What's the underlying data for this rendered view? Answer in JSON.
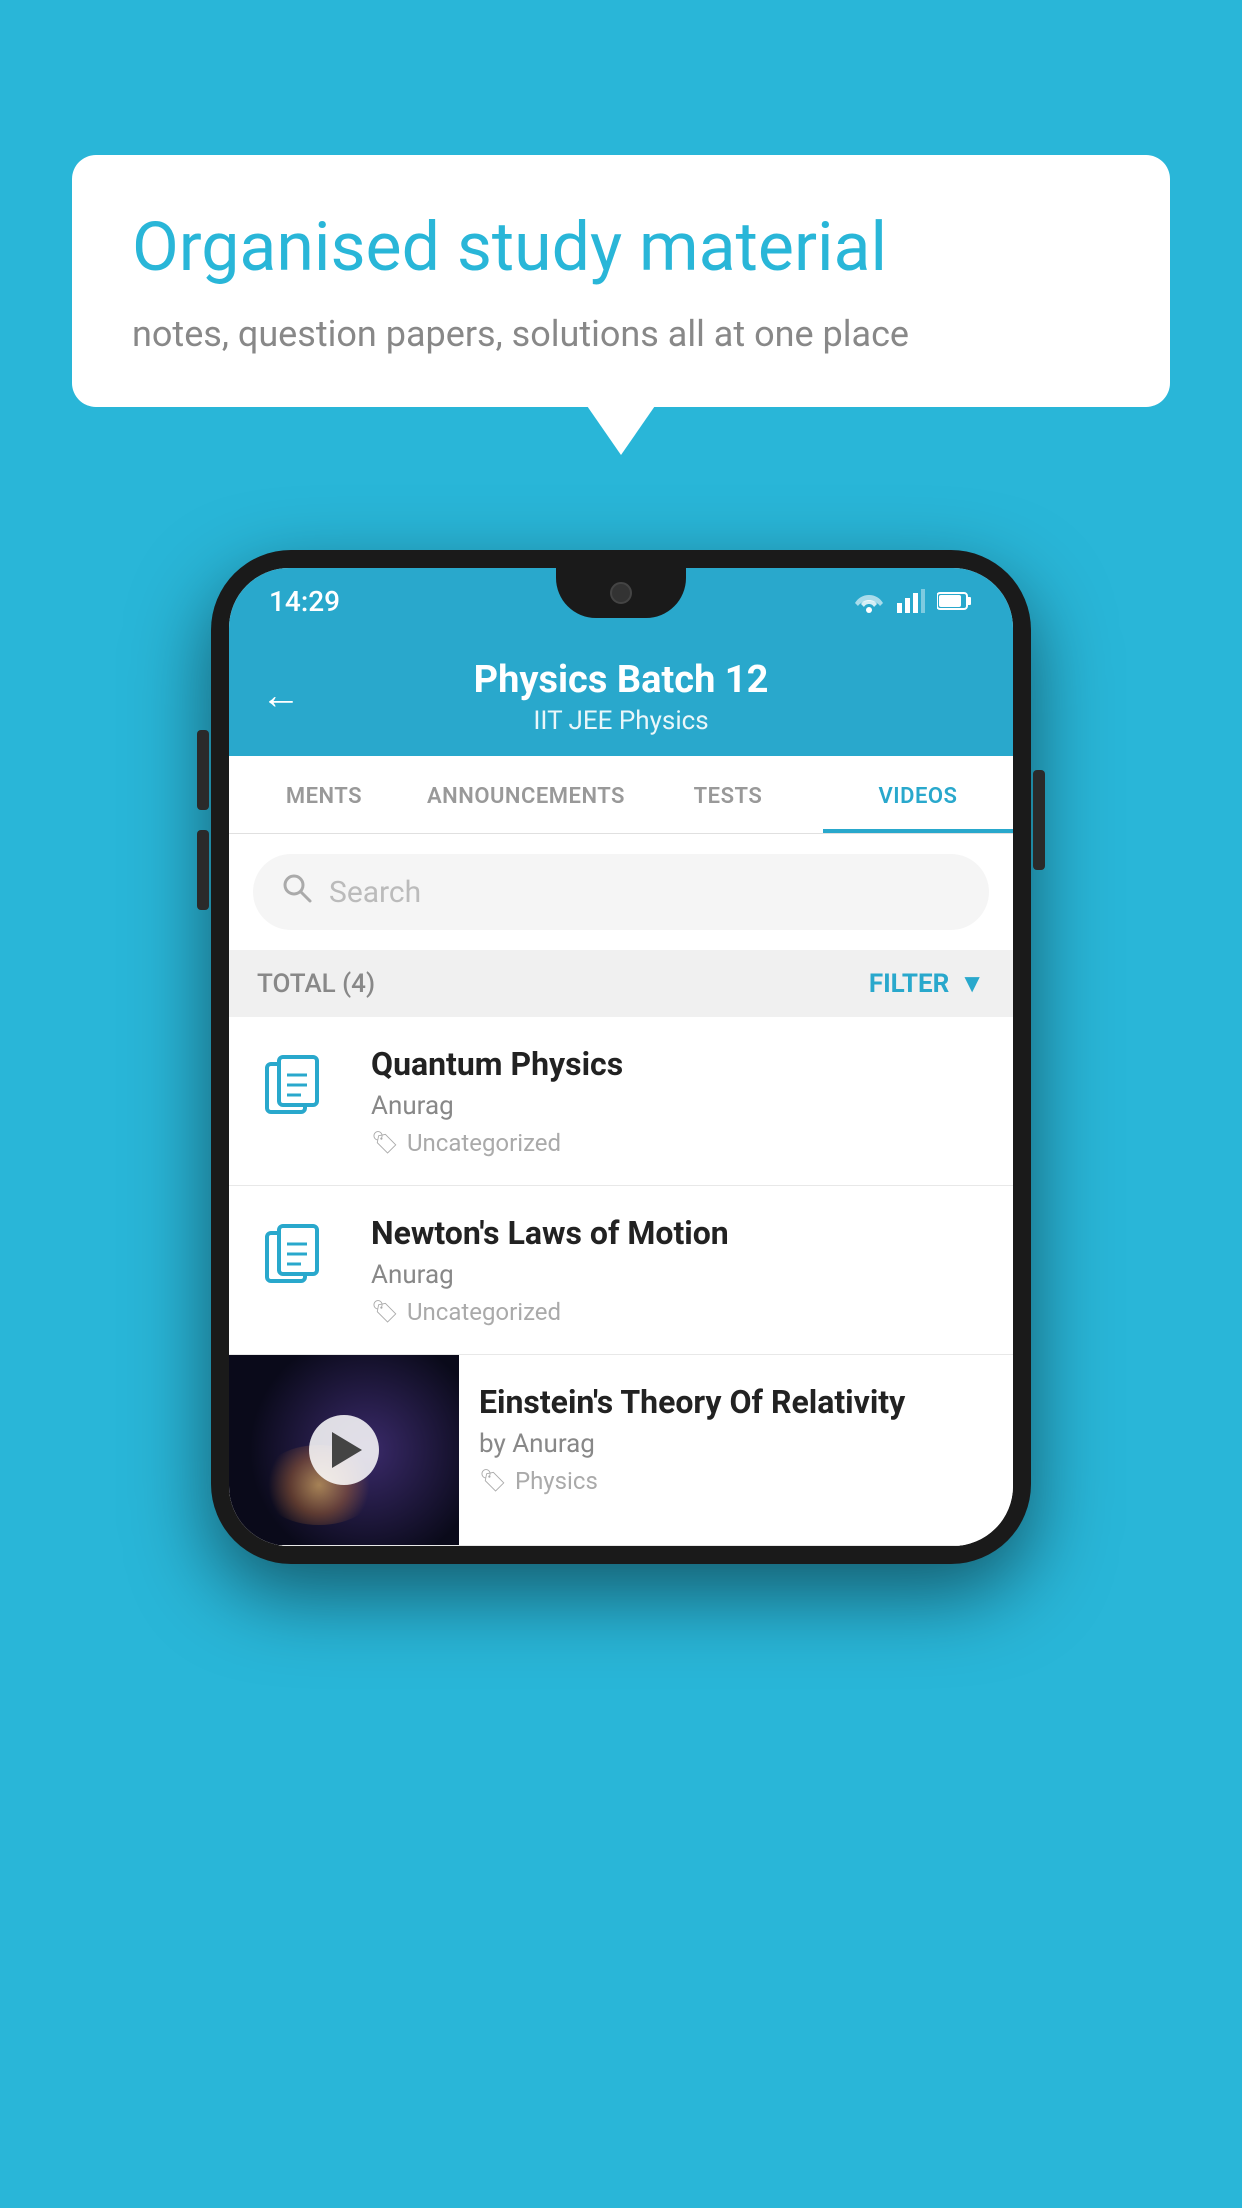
{
  "background_color": "#29B6D8",
  "bubble": {
    "title": "Organised study material",
    "subtitle": "notes, question papers, solutions all at one place"
  },
  "phone": {
    "status_bar": {
      "time": "14:29",
      "icons": [
        "wifi",
        "signal",
        "battery"
      ]
    },
    "header": {
      "title": "Physics Batch 12",
      "subtitle": "IIT JEE    Physics",
      "back_label": "←"
    },
    "tabs": [
      {
        "label": "MENTS",
        "active": false
      },
      {
        "label": "ANNOUNCEMENTS",
        "active": false
      },
      {
        "label": "TESTS",
        "active": false
      },
      {
        "label": "VIDEOS",
        "active": true
      }
    ],
    "search": {
      "placeholder": "Search"
    },
    "filter_bar": {
      "total": "TOTAL (4)",
      "filter_label": "FILTER"
    },
    "videos": [
      {
        "title": "Quantum Physics",
        "author": "Anurag",
        "tag": "Uncategorized",
        "has_thumbnail": false
      },
      {
        "title": "Newton's Laws of Motion",
        "author": "Anurag",
        "tag": "Uncategorized",
        "has_thumbnail": false
      },
      {
        "title": "Einstein's Theory Of Relativity",
        "author": "by Anurag",
        "tag": "Physics",
        "has_thumbnail": true
      }
    ]
  }
}
